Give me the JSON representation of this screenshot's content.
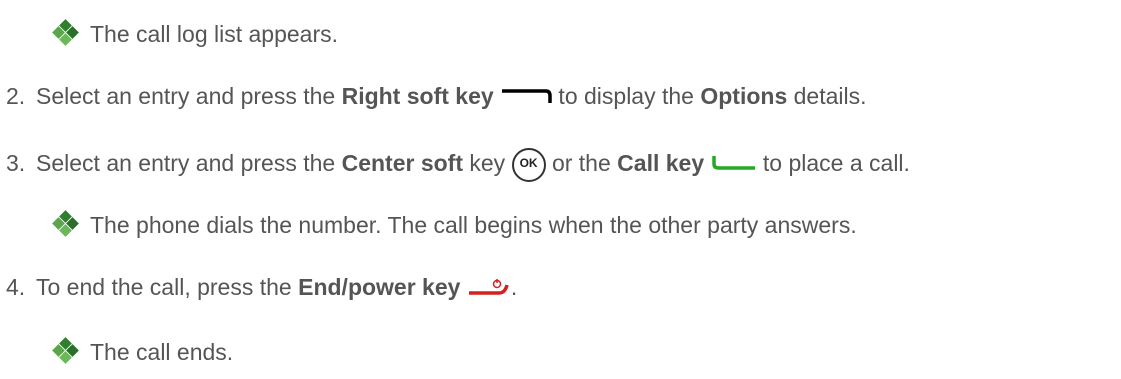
{
  "line1": {
    "text": "The call log list appears."
  },
  "step2": {
    "number": "2.",
    "t1": "Select an entry and press the ",
    "b1": "Right soft key",
    "t2": " to display the ",
    "b2": "Options",
    "t3": " details."
  },
  "step3": {
    "number": "3.",
    "t1": "Select an entry and press the ",
    "b1": "Center soft",
    "t2": " key",
    "ok_label": "OK",
    "t3": " or the ",
    "b2": "Call key",
    "t4": " to place a call."
  },
  "line4": {
    "text": "The phone dials the number. The call begins when the other party answers."
  },
  "step4": {
    "number": "4.",
    "t1": "To end the call, press the ",
    "b1": "End/power key",
    "t2": "."
  },
  "line6": {
    "text": "The call ends."
  },
  "icons": {
    "bullet": "green-diamond-bullet-icon",
    "right_soft_key": "right-soft-key-icon",
    "center_ok_key": "ok-key-icon",
    "call_key": "call-key-icon",
    "end_power_key": "end-power-key-icon"
  },
  "colors": {
    "text": "#555555",
    "bullet_green": "#3b8f3b",
    "call_key_green": "#22aa22",
    "end_key_red": "#d42020"
  }
}
